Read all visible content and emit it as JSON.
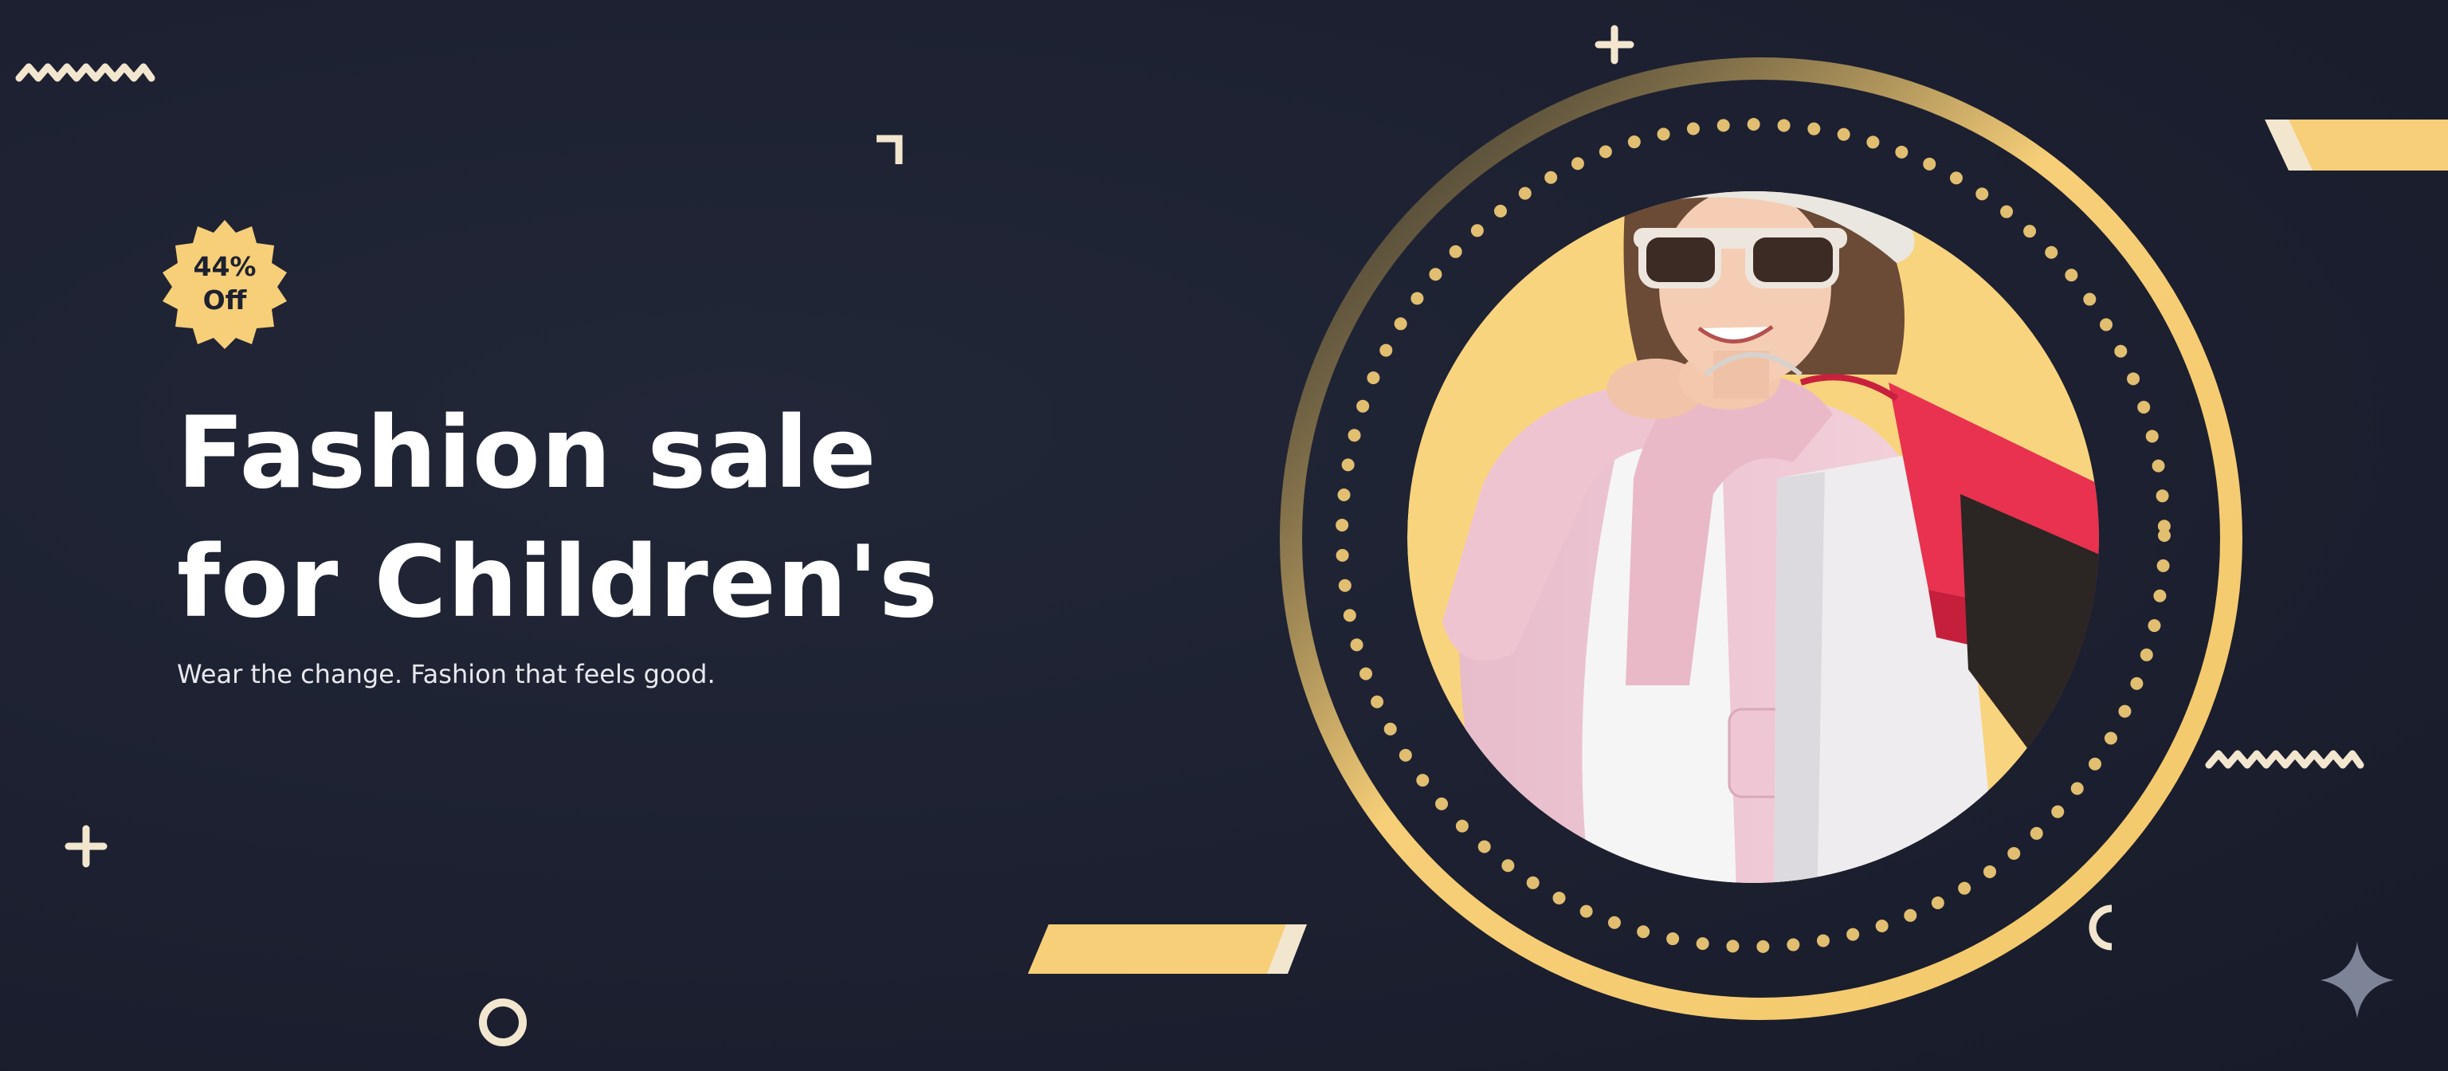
{
  "banner": {
    "badge": {
      "percent": "44%",
      "label": "Off"
    },
    "headline": {
      "line1": "Fashion sale",
      "line2": "for Children's"
    },
    "subheadline": "Wear the change. Fashion that feels good."
  },
  "hero_image": {
    "subject": "girl-with-shopping-bags",
    "icons": [
      "sunglasses-icon",
      "hat-icon",
      "shopping-bag-icon"
    ]
  },
  "colors": {
    "background": "#1d2130",
    "accent": "#f7cf78",
    "text": "#ffffff",
    "muted": "#8a90a3"
  }
}
